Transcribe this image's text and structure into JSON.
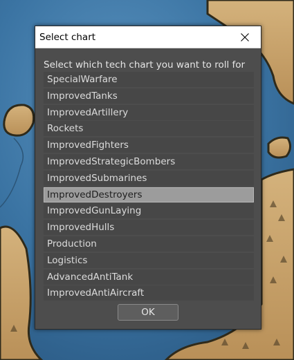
{
  "dialog": {
    "title": "Select chart",
    "close_icon": "close-icon",
    "prompt": "Select which tech chart you want to roll for",
    "ok_label": "OK"
  },
  "charts": [
    {
      "label": "SpecialWarfare",
      "selected": false
    },
    {
      "label": "ImprovedTanks",
      "selected": false
    },
    {
      "label": "ImprovedArtillery",
      "selected": false
    },
    {
      "label": "Rockets",
      "selected": false
    },
    {
      "label": "ImprovedFighters",
      "selected": false
    },
    {
      "label": "ImprovedStrategicBombers",
      "selected": false
    },
    {
      "label": "ImprovedSubmarines",
      "selected": false
    },
    {
      "label": "ImprovedDestroyers",
      "selected": true
    },
    {
      "label": "ImprovedGunLaying",
      "selected": false
    },
    {
      "label": "ImprovedHulls",
      "selected": false
    },
    {
      "label": "Production",
      "selected": false
    },
    {
      "label": "Logistics",
      "selected": false
    },
    {
      "label": "AdvancedAntiTank",
      "selected": false
    },
    {
      "label": "ImprovedAntiAircraft",
      "selected": false
    }
  ],
  "colors": {
    "dialog_bg": "#4d4d4d",
    "selected_bg": "#9c9c9c",
    "sea": "#3f79a8",
    "land": "#c9a36b"
  }
}
